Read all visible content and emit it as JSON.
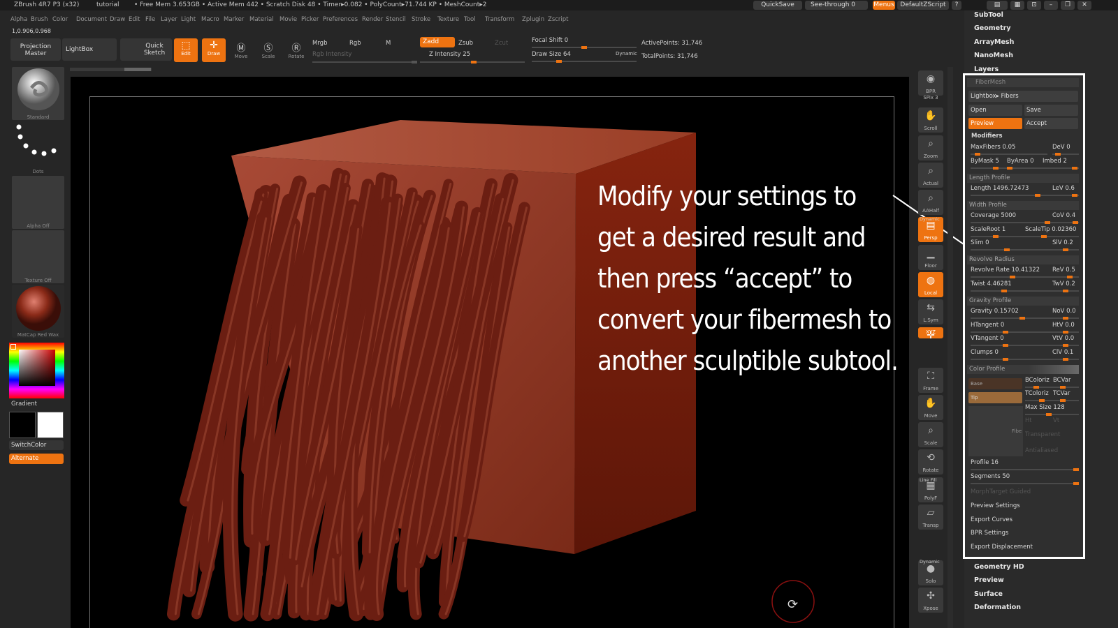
{
  "titlebar": {
    "app": "ZBrush 4R7 P3 (x32)",
    "doc": "tutorial",
    "stats": "• Free Mem 3.653GB • Active Mem 442 • Scratch Disk 48 • Timer▸0.082 • PolyCount▸71.744 KP • MeshCount▸2",
    "quicksave": "QuickSave",
    "seethrough": "See-through  0",
    "menus": "Menus",
    "script": "DefaultZScript"
  },
  "menubar": [
    "Alpha",
    "Brush",
    "Color",
    "Document",
    "Draw",
    "Edit",
    "File",
    "Layer",
    "Light",
    "Macro",
    "Marker",
    "Material",
    "Movie",
    "Picker",
    "Preferences",
    "Render",
    "Stencil",
    "Stroke",
    "Texture",
    "Tool",
    "Transform",
    "Zplugin",
    "Zscript"
  ],
  "coords": "1,0.906,0.968",
  "toolbar": {
    "projection": "Projection Master",
    "lightbox": "LightBox",
    "quicksketch": "Quick Sketch",
    "edit": "Edit",
    "draw": "Draw",
    "move": "Move",
    "scale": "Scale",
    "rotate": "Rotate",
    "mrgb": "Mrgb",
    "rgb": "Rgb",
    "m": "M",
    "rgb_intensity": "Rgb Intensity",
    "zadd": "Zadd",
    "zsub": "Zsub",
    "zcut": "Zcut",
    "z_intensity": "Z Intensity 25",
    "focal_shift": "Focal Shift 0",
    "draw_size": "Draw Size 64",
    "dynamic": "Dynamic",
    "active_points": "ActivePoints: 31,746",
    "total_points": "TotalPoints: 31,746"
  },
  "left": {
    "brush": "Standard",
    "stroke": "Dots",
    "alpha": "Alpha  Off",
    "texture": "Texture  Off",
    "material": "MatCap Red Wax",
    "gradient": "Gradient",
    "switchcolor": "SwitchColor",
    "alternate": "Alternate"
  },
  "right_shelf": [
    "BPR",
    "SPix 3",
    "Scroll",
    "Zoom",
    "Actual",
    "AAHalf",
    "Persp",
    "Floor",
    "Local",
    "L.Sym",
    "XYZ",
    "Frame",
    "Move",
    "Scale",
    "Rotate",
    "PolyF",
    "Transp",
    "Solo",
    "Xpose"
  ],
  "right_shelf_extra": {
    "dynamic": "Dynamic",
    "linefill": "Line Fill",
    "dynamic2": "Dynamic"
  },
  "trays": {
    "subtool": "SubTool",
    "geometry": "Geometry",
    "arraymesh": "ArrayMesh",
    "nanomesh": "NanoMesh",
    "layers": "Layers",
    "geometry_hd": "Geometry HD",
    "preview": "Preview",
    "surface": "Surface",
    "deformation": "Deformation"
  },
  "fibermesh": {
    "title": "FiberMesh",
    "lightbox": "Lightbox▸ Fibers",
    "open": "Open",
    "save": "Save",
    "preview": "Preview",
    "accept": "Accept",
    "modifiers": "Modifiers",
    "maxfibers": "MaxFibers 0.05",
    "dev": "DeV 0",
    "bymask": "ByMask 5",
    "byarea": "ByArea 0",
    "imbed": "Imbed 2",
    "length_profile": "Length Profile",
    "length": "Length 1496.72473",
    "lev": "LeV 0.6",
    "width_profile": "Width Profile",
    "coverage": "Coverage 5000",
    "cov": "CoV 0.4",
    "scaleroot": "ScaleRoot 1",
    "scaletip": "ScaleTip 0.02360",
    "slim": "Slim 0",
    "slv": "SlV 0.2",
    "revolve_radius": "Revolve Radius",
    "revolve_rate": "Revolve Rate 10.41322",
    "rev": "ReV 0.5",
    "twist": "Twist 4.46281",
    "twv": "TwV 0.2",
    "gravity_profile": "Gravity Profile",
    "gravity": "Gravity 0.15702",
    "nov": "NoV 0.0",
    "htangent": "HTangent 0",
    "htv": "HtV 0.0",
    "vtangent": "VTangent 0",
    "vtv": "VtV 0.0",
    "clumps": "Clumps 0",
    "clv": "ClV 0.1",
    "color_profile": "Color Profile",
    "base": "Base",
    "tip": "Tip",
    "bcolorize": "BColoriz",
    "bcvar": "BCVar",
    "tcolorize": "TColoriz",
    "tcvar": "TCVar",
    "maxsize": "Max Size 128",
    "ht": "Ht",
    "vt": "Vt",
    "fibe": "Fibe",
    "transparent": "Transparent",
    "antialiased": "Antialiased",
    "profile": "Profile 16",
    "segments": "Segments 50",
    "morph": "MorphTarget Guided",
    "preview_settings": "Preview Settings",
    "export_curves": "Export Curves",
    "bpr_settings": "BPR Settings",
    "export_displacement": "Export Displacement"
  },
  "callout": "Modify your settings to get a desired result and then press “accept” to convert your fibermesh to another sculptible subtool.",
  "colors": {
    "accent": "#ee7311",
    "cube": "#8a3018",
    "fiber": "#6b1e12",
    "bg": "#262626"
  }
}
